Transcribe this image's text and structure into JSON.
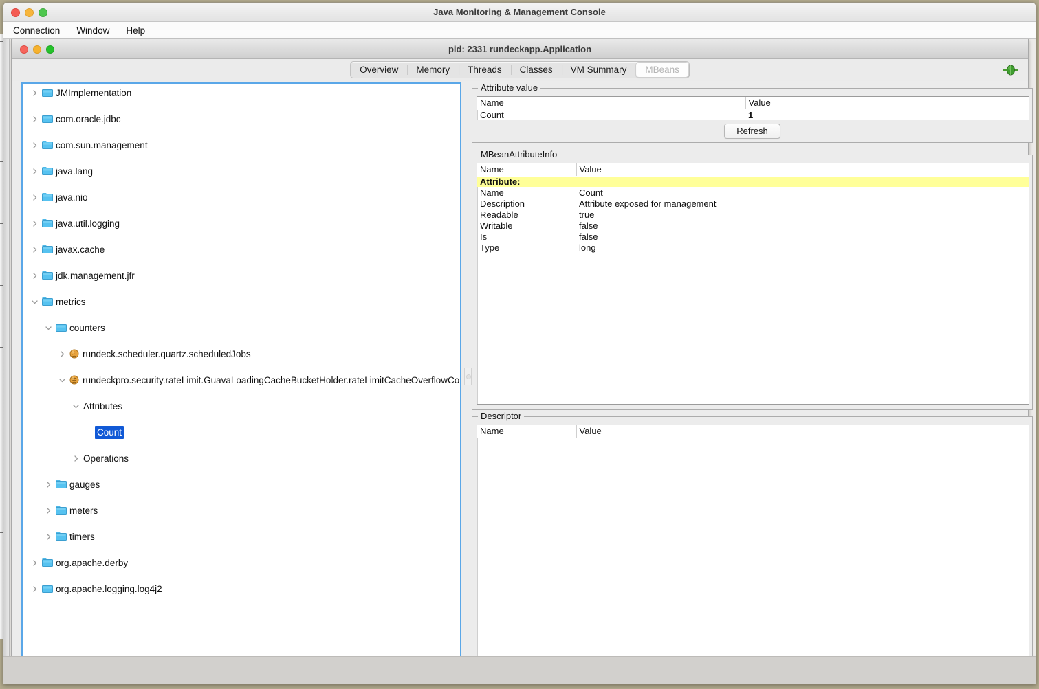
{
  "outer_window": {
    "title": "Java Monitoring & Management Console",
    "traffic_lights": [
      "close-button",
      "minimize-button",
      "maximize-button"
    ]
  },
  "menubar": {
    "items": [
      {
        "label": "Connection"
      },
      {
        "label": "Window"
      },
      {
        "label": "Help"
      }
    ]
  },
  "inner_window": {
    "title": "pid: 2331 rundeckapp.Application"
  },
  "tabs": {
    "items": [
      {
        "label": "Overview",
        "selected": false
      },
      {
        "label": "Memory",
        "selected": false
      },
      {
        "label": "Threads",
        "selected": false
      },
      {
        "label": "Classes",
        "selected": false
      },
      {
        "label": "VM Summary",
        "selected": false
      },
      {
        "label": "MBeans",
        "selected": true
      }
    ],
    "connect_icon": "connect-plug-icon"
  },
  "tree": {
    "nodes": [
      {
        "label": "JMImplementation",
        "depth": 0,
        "twist": "collapsed",
        "icon": "folder-icon",
        "selected": false
      },
      {
        "label": "com.oracle.jdbc",
        "depth": 0,
        "twist": "collapsed",
        "icon": "folder-icon",
        "selected": false
      },
      {
        "label": "com.sun.management",
        "depth": 0,
        "twist": "collapsed",
        "icon": "folder-icon",
        "selected": false
      },
      {
        "label": "java.lang",
        "depth": 0,
        "twist": "collapsed",
        "icon": "folder-icon",
        "selected": false
      },
      {
        "label": "java.nio",
        "depth": 0,
        "twist": "collapsed",
        "icon": "folder-icon",
        "selected": false
      },
      {
        "label": "java.util.logging",
        "depth": 0,
        "twist": "collapsed",
        "icon": "folder-icon",
        "selected": false
      },
      {
        "label": "javax.cache",
        "depth": 0,
        "twist": "collapsed",
        "icon": "folder-icon",
        "selected": false
      },
      {
        "label": "jdk.management.jfr",
        "depth": 0,
        "twist": "collapsed",
        "icon": "folder-icon",
        "selected": false
      },
      {
        "label": "metrics",
        "depth": 0,
        "twist": "expanded",
        "icon": "folder-icon",
        "selected": false
      },
      {
        "label": "counters",
        "depth": 1,
        "twist": "expanded",
        "icon": "folder-icon",
        "selected": false
      },
      {
        "label": "rundeck.scheduler.quartz.scheduledJobs",
        "depth": 2,
        "twist": "collapsed",
        "icon": "mbean-icon",
        "selected": false
      },
      {
        "label": "rundeckpro.security.rateLimit.GuavaLoadingCacheBucketHolder.rateLimitCacheOverflowCount",
        "depth": 2,
        "twist": "expanded",
        "icon": "mbean-icon",
        "selected": false
      },
      {
        "label": "Attributes",
        "depth": 3,
        "twist": "expanded",
        "icon": "none",
        "selected": false
      },
      {
        "label": "Count",
        "depth": 4,
        "twist": "none",
        "icon": "none",
        "selected": true
      },
      {
        "label": "Operations",
        "depth": 3,
        "twist": "collapsed",
        "icon": "none",
        "selected": false
      },
      {
        "label": "gauges",
        "depth": 1,
        "twist": "collapsed",
        "icon": "folder-icon",
        "selected": false
      },
      {
        "label": "meters",
        "depth": 1,
        "twist": "collapsed",
        "icon": "folder-icon",
        "selected": false
      },
      {
        "label": "timers",
        "depth": 1,
        "twist": "collapsed",
        "icon": "folder-icon",
        "selected": false
      },
      {
        "label": "org.apache.derby",
        "depth": 0,
        "twist": "collapsed",
        "icon": "folder-icon",
        "selected": false
      },
      {
        "label": "org.apache.logging.log4j2",
        "depth": 0,
        "twist": "collapsed",
        "icon": "folder-icon",
        "selected": false
      }
    ]
  },
  "attribute_value": {
    "title": "Attribute value",
    "columns": [
      "Name",
      "Value"
    ],
    "rows": [
      {
        "name": "Count",
        "value": "1",
        "value_bold": true
      }
    ],
    "refresh_label": "Refresh"
  },
  "mbean_attribute_info": {
    "title": "MBeanAttributeInfo",
    "columns": [
      "Name",
      "Value"
    ],
    "rows": [
      {
        "name": "Attribute:",
        "value": "",
        "highlight": true
      },
      {
        "name": "Name",
        "value": "Count",
        "highlight": false
      },
      {
        "name": "Description",
        "value": "Attribute exposed for management",
        "highlight": false
      },
      {
        "name": "Readable",
        "value": "true",
        "highlight": false
      },
      {
        "name": "Writable",
        "value": "false",
        "highlight": false
      },
      {
        "name": "Is",
        "value": "false",
        "highlight": false
      },
      {
        "name": "Type",
        "value": "long",
        "highlight": false
      }
    ]
  },
  "descriptor": {
    "title": "Descriptor",
    "columns": [
      "Name",
      "Value"
    ],
    "rows": []
  },
  "colors": {
    "selection_blue": "#1159d6",
    "highlight_yellow": "#ffff99",
    "focus_border": "#5aa7e8",
    "folder_icon": "#56c2f0",
    "mbean_icon": "#e8a33d",
    "connect_green": "#3f9e2f"
  }
}
